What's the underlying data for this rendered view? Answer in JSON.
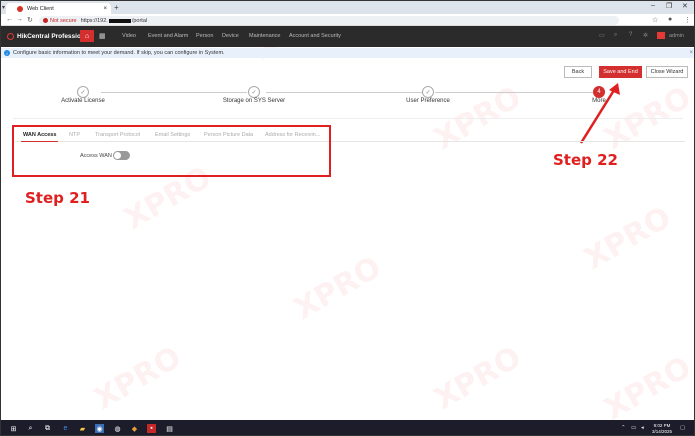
{
  "browser": {
    "tab_title": "Web Client",
    "new_tab": "+",
    "not_secure": "Not secure",
    "url_prefix": "https://192.",
    "url_suffix": "/portal",
    "minimize": "–",
    "maximize": "❐",
    "close": "✕"
  },
  "app": {
    "name": "HikCentral Professional",
    "menu": [
      "Video",
      "Event and Alarm",
      "Person",
      "Device",
      "Maintenance",
      "Account and Security"
    ],
    "admin": "admin"
  },
  "infobar": {
    "message": "Configure basic information to meet your demand. If skip, you can configure in System."
  },
  "wizard": {
    "back": "Back",
    "save_and_end": "Save and End",
    "close_wizard": "Close Wizard",
    "steps": [
      {
        "label": "Activate License",
        "marker": "✓"
      },
      {
        "label": "Storage on SYS Server",
        "marker": "✓"
      },
      {
        "label": "User Preference",
        "marker": "✓"
      },
      {
        "label": "More",
        "marker": "4"
      }
    ]
  },
  "tabs": [
    "WAN Access",
    "NTP",
    "Transport Protocol",
    "Email Settings",
    "Person Picture Data",
    "Address for Receivin..."
  ],
  "form": {
    "access_wan_label": "Access WAN"
  },
  "annotations": {
    "step21": "Step 21",
    "step22": "Step 22"
  },
  "watermark": "XPRO",
  "taskbar": {
    "time": "9:02 PM",
    "date": "3/14/2025"
  },
  "colors": {
    "accent": "#d32f2f",
    "annotation": "#e02020",
    "header_bg": "#2b2b2b"
  }
}
